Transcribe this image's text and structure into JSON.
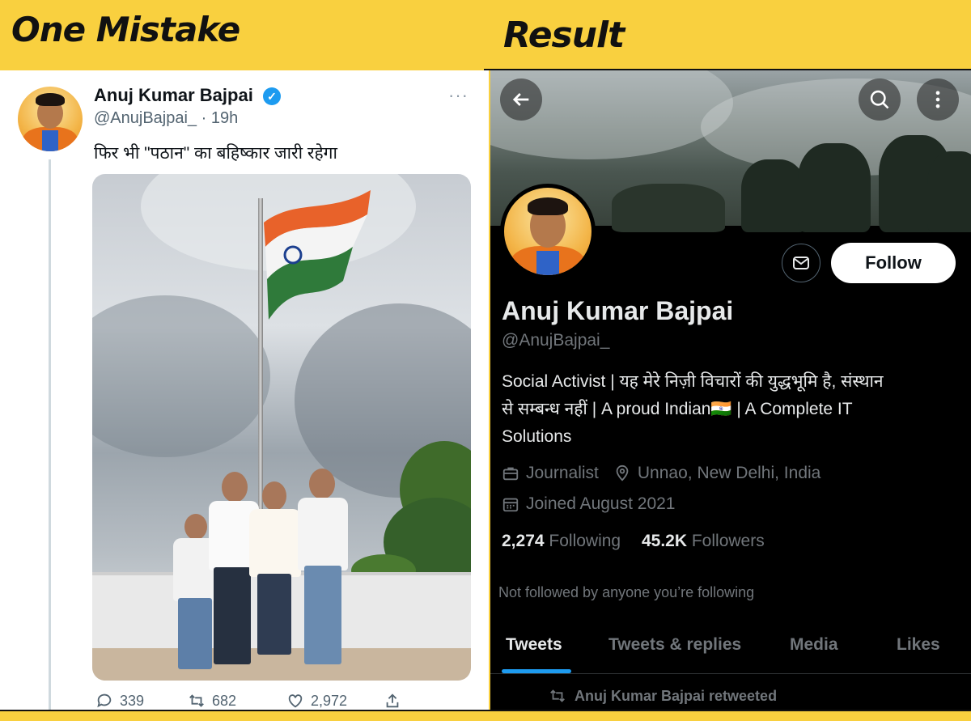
{
  "headers": {
    "left": "One Mistake",
    "right": "Result"
  },
  "tweet": {
    "name": "Anuj Kumar Bajpai",
    "handle": "@AnujBajpai_ · 19h",
    "more": "···",
    "text": "फिर भी \"पठान\" का बहिष्कार जारी रहेगा",
    "stats": {
      "replies": "339",
      "retweets": "682",
      "likes": "2,972"
    }
  },
  "profile": {
    "name": "Anuj Kumar Bajpai",
    "handle": "@AnujBajpai_",
    "follow_label": "Follow",
    "bio_line1": "Social Activist | यह मेरे निज़ी विचारों की युद्धभूमि है, संस्थान",
    "bio_line2": "से सम्बन्ध नहीं | A proud Indian🇮🇳 | A Complete IT",
    "bio_line3": "Solutions",
    "profession": "Journalist",
    "location": "Unnao, New Delhi, India",
    "joined": "Joined August 2021",
    "following_count": "2,274",
    "following_label": "Following",
    "followers_count": "45.2K",
    "followers_label": "Followers",
    "not_followed": "Not followed by anyone you’re following",
    "tabs": [
      "Tweets",
      "Tweets & replies",
      "Media",
      "Likes"
    ],
    "retweet_line": "Anuj Kumar Bajpai retweeted"
  },
  "colors": {
    "background": "#f9d03f",
    "accent": "#1d9bf0",
    "profile_bg": "#000000"
  }
}
